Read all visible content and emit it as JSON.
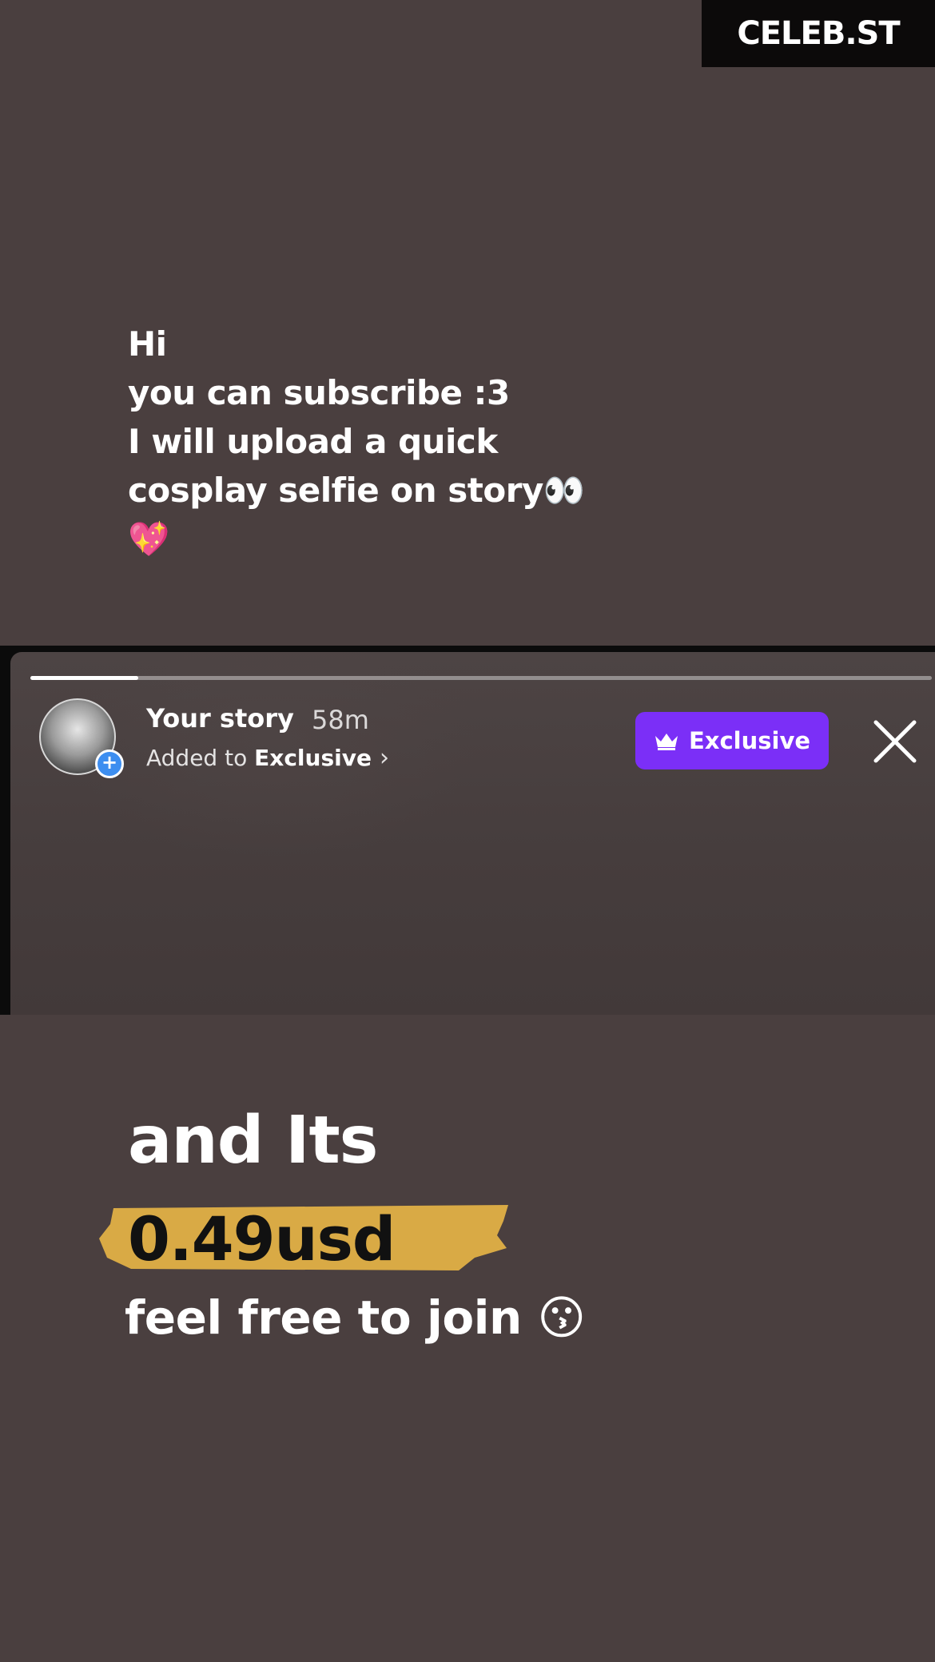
{
  "watermark": {
    "text": "CELEB.ST"
  },
  "message": {
    "lines": [
      "Hi",
      "you can subscribe :3",
      "I will upload a quick",
      "cosplay selfie on story👀",
      "💖"
    ]
  },
  "story": {
    "progress_fraction": 0.12,
    "title": "Your story",
    "time": "58m",
    "subtitle_prefix": "Added to",
    "subtitle_link": "Exclusive",
    "badge_label": "Exclusive",
    "avatar_icon": "avatar-with-plus",
    "close_icon": "close-x-icon"
  },
  "bottom": {
    "and_its": "and Its",
    "price": "0.49usd",
    "highlight_color": "#d9aa45",
    "feel_free": "feel free to join 😗"
  },
  "colors": {
    "background": "#4a3f3f",
    "accent_purple": "#7b2ff7",
    "plus_blue": "#3d8ef0"
  }
}
